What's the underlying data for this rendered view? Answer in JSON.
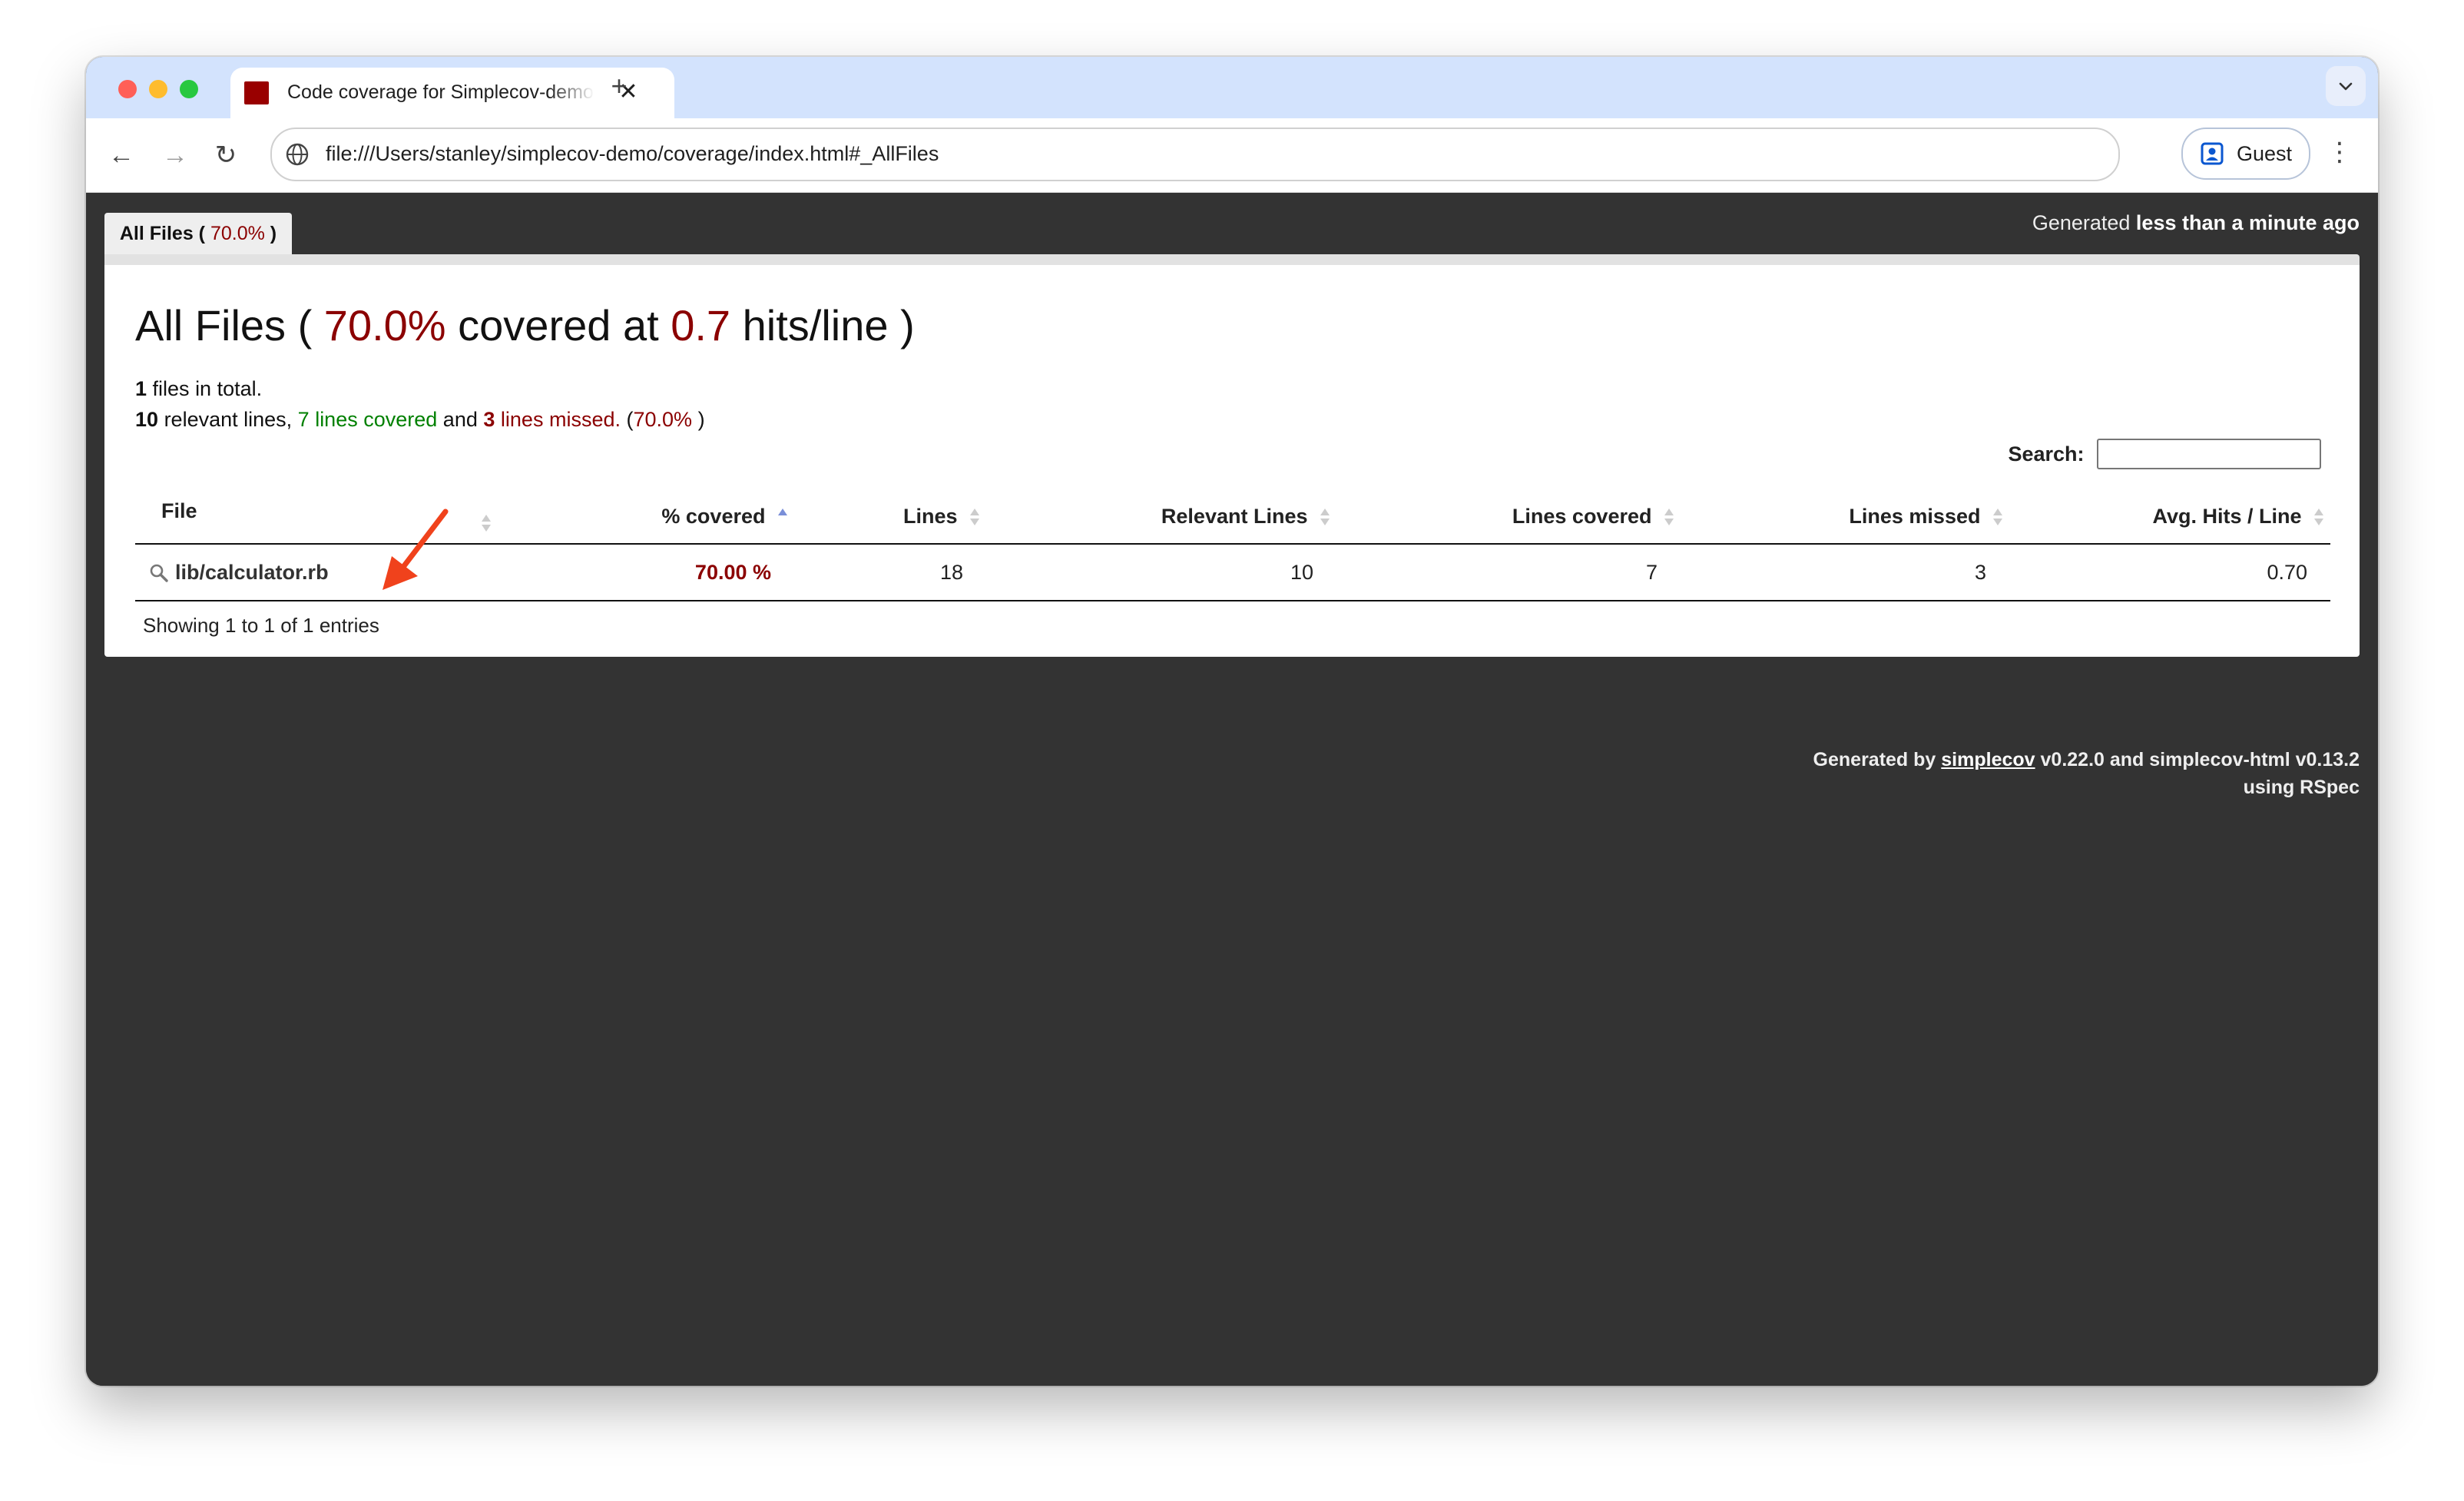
{
  "browser": {
    "tab_title": "Code coverage for Simplecov-demo",
    "tab_close": "✕",
    "new_tab": "+",
    "url": "file:///Users/stanley/simplecov-demo/coverage/index.html#_AllFiles",
    "guest_label": "Guest",
    "back": "←",
    "forward": "→",
    "reload": "↻",
    "menu": "⋮"
  },
  "report": {
    "tab_label_prefix": "All Files (",
    "tab_label_pct": "70.0%",
    "tab_label_suffix": ")",
    "generated_prefix": "Generated",
    "generated_time": "less than a minute ago",
    "heading": {
      "prefix": "All Files (",
      "pct": "70.0%",
      "middle": "covered at",
      "hits": "0.7",
      "suffix": "hits/line )"
    },
    "summary": {
      "files_count": "1",
      "files_text": "files in total.",
      "relevant_count": "10",
      "relevant_text": "relevant lines,",
      "covered_text": "7 lines covered",
      "and_text": "and",
      "missed_count": "3",
      "missed_text": "lines missed.",
      "pct_open": "(",
      "pct": "70.0%",
      "pct_close": ")"
    },
    "search_label": "Search:",
    "search_value": "",
    "columns": [
      "File",
      "% covered",
      "Lines",
      "Relevant Lines",
      "Lines covered",
      "Lines missed",
      "Avg. Hits / Line"
    ],
    "rows": [
      {
        "file": "lib/calculator.rb",
        "covered": "70.00 %",
        "lines": "18",
        "relevant": "10",
        "lines_covered": "7",
        "lines_missed": "3",
        "avg_hits": "0.70"
      }
    ],
    "showing": "Showing 1 to 1 of 1 entries",
    "footer": {
      "prefix": "Generated by",
      "link": "simplecov",
      "middle": "v0.22.0 and simplecov-html v0.13.2",
      "line2": "using RSpec"
    }
  },
  "colors": {
    "accent_red": "#8b0000",
    "covered_green": "#008000",
    "page_background": "#333333",
    "annotation_arrow": "#f0421c",
    "favicon": "#990000"
  },
  "icons": [
    "search-icon",
    "sort-icon",
    "sort-asc-icon",
    "site-info-icon",
    "profile-icon",
    "chevron-down-icon"
  ]
}
